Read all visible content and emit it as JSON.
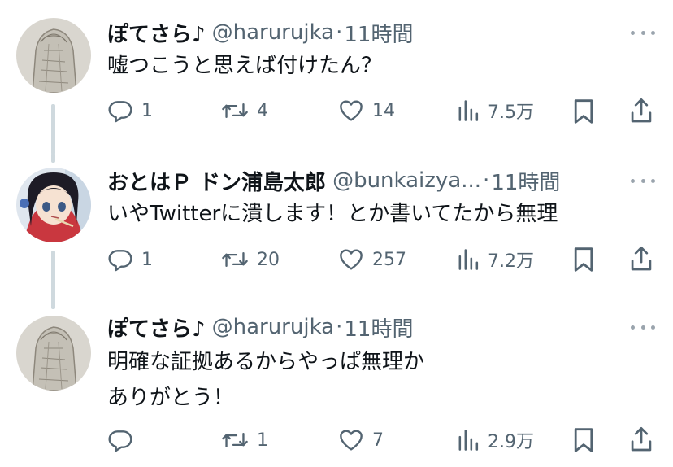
{
  "tweets": [
    {
      "name": "ぽてさら♪",
      "handle": "@harurujka",
      "separator": "·",
      "time": "11時間",
      "text": "嘘つこうと思えば付けたん？",
      "replies": "1",
      "retweets": "4",
      "likes": "14",
      "views": "7.5万",
      "avatar_icon": "sketch-avatar"
    },
    {
      "name": "おとはＰ ドン浦島太郎",
      "handle": "@bunkaizya...",
      "separator": "·",
      "time": "11時間",
      "text": "いやTwitterに潰します！とか書いてたから無理",
      "replies": "1",
      "retweets": "20",
      "likes": "257",
      "views": "7.2万",
      "avatar_icon": "anime-girl-avatar"
    },
    {
      "name": "ぽてさら♪",
      "handle": "@harurujka",
      "separator": "·",
      "time": "11時間",
      "text_line1": "明確な証拠あるからやっぱ無理か",
      "text_line2": "ありがとう！",
      "replies": "",
      "retweets": "1",
      "likes": "7",
      "views": "2.9万",
      "avatar_icon": "sketch-avatar"
    }
  ],
  "colors": {
    "text": "#0f1419",
    "muted": "#536471",
    "thread_line": "#cfd9de",
    "background": "#ffffff"
  }
}
